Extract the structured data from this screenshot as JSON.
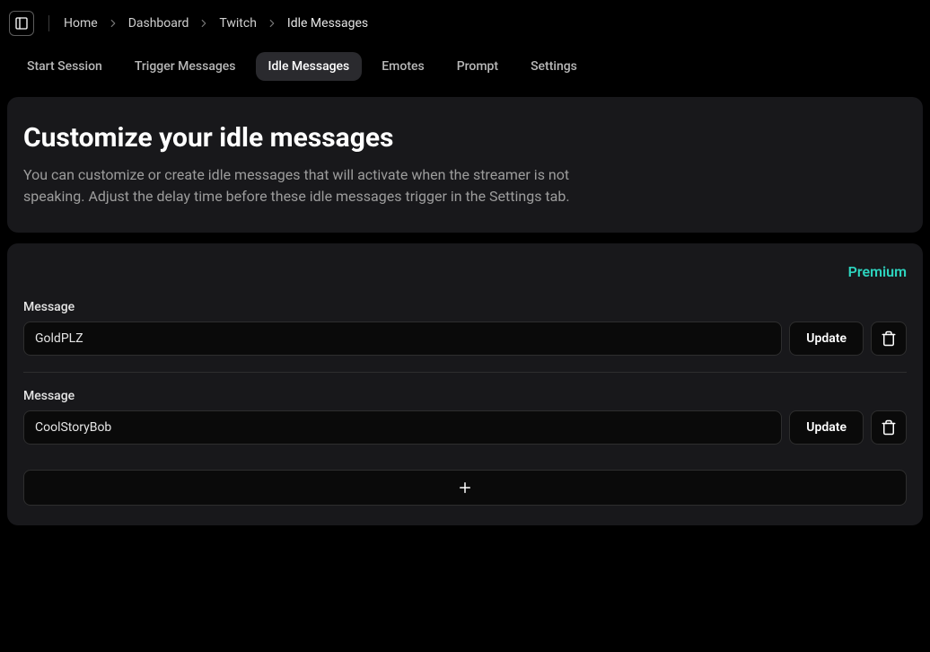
{
  "breadcrumb": {
    "items": [
      "Home",
      "Dashboard",
      "Twitch",
      "Idle Messages"
    ]
  },
  "tabs": {
    "items": [
      {
        "label": "Start Session",
        "active": false
      },
      {
        "label": "Trigger Messages",
        "active": false
      },
      {
        "label": "Idle Messages",
        "active": true
      },
      {
        "label": "Emotes",
        "active": false
      },
      {
        "label": "Prompt",
        "active": false
      },
      {
        "label": "Settings",
        "active": false
      }
    ]
  },
  "header": {
    "title": "Customize your idle messages",
    "description": "You can customize or create idle messages that will activate when the streamer is not speaking. Adjust the delay time before these idle messages trigger in the Settings tab."
  },
  "panel": {
    "premium_label": "Premium",
    "message_label": "Message",
    "update_label": "Update",
    "messages": [
      {
        "value": "GoldPLZ"
      },
      {
        "value": "CoolStoryBob"
      }
    ]
  }
}
